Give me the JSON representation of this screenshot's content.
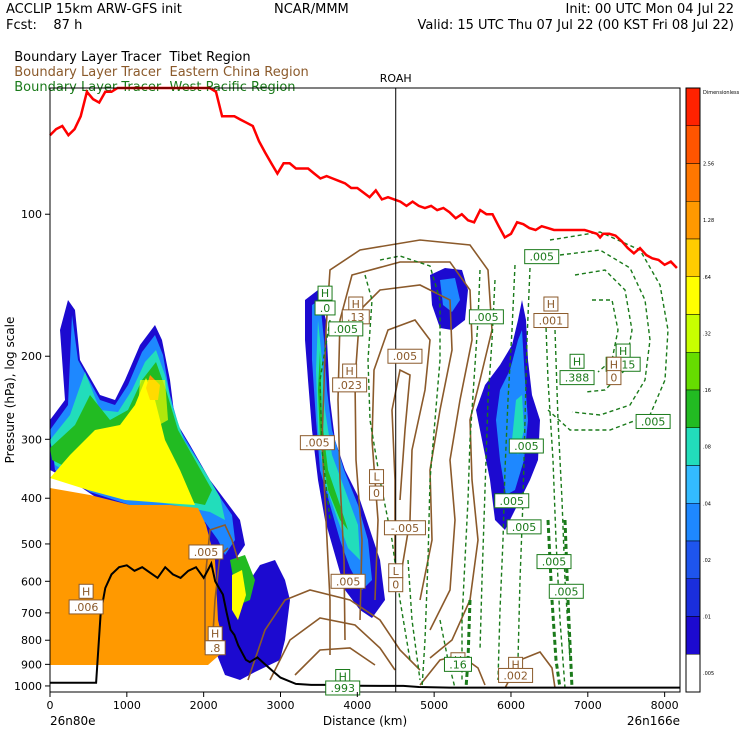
{
  "header": {
    "model": "ACCLIP 15km ARW-GFS init",
    "org": "NCAR/MMM",
    "init": "Init: 00 UTC Mon 04 Jul 22",
    "fcst": "Fcst:    87 h",
    "valid": "Valid: 15 UTC Thu 07 Jul 22 (00 KST Fri 08 Jul 22)"
  },
  "legend": [
    {
      "name": "Boundary Layer Tracer",
      "region": "Tibet Region",
      "color": "#000000"
    },
    {
      "name": "Boundary Layer Tracer",
      "region": "Eastern China Region",
      "color": "#8b5a2b"
    },
    {
      "name": "Boundary Layer Tracer",
      "region": "West Pacific Region",
      "color": "#1a7a1a"
    }
  ],
  "colors": {
    "tropopause": "#ff0000",
    "terrain": "#000000",
    "china": "#8b5a2b",
    "pacific": "#1a7a1a"
  },
  "chart_data": {
    "type": "cross-section",
    "marker_label": "ROAH",
    "marker_x": 4500,
    "xlabel": "Distance (km)",
    "ylabel": "Pressure (hPa), log scale",
    "x_range": [
      0,
      8200
    ],
    "y_range_hpa": [
      1030,
      54
    ],
    "y_scale": "log",
    "x_ticks": [
      "0",
      "1000",
      "2000",
      "3000",
      "4000",
      "5000",
      "6000",
      "7000",
      "8000"
    ],
    "x_tick_values": [
      0,
      1000,
      2000,
      3000,
      4000,
      5000,
      6000,
      7000,
      8000
    ],
    "y_ticks": [
      "1000",
      "900",
      "800",
      "700",
      "600",
      "500",
      "400",
      "300",
      "200",
      "100"
    ],
    "y_tick_values": [
      1000,
      900,
      800,
      700,
      600,
      500,
      400,
      300,
      200,
      100
    ],
    "endpoint_left": "26n80e",
    "endpoint_right": "26n166e",
    "colorbar_labels": [
      "Dimensionless",
      "2.56",
      "1.28",
      ".64",
      ".32",
      ".16",
      ".08",
      ".04",
      ".02",
      ".01",
      ".005"
    ],
    "colorbar_colors": [
      "#ff2200",
      "#ff5500",
      "#ff7700",
      "#ff9900",
      "#ffcc00",
      "#ffff00",
      "#c8ff00",
      "#66dd00",
      "#22bb22",
      "#22ddbb",
      "#33bbff",
      "#1e88ff",
      "#1e55ee",
      "#1a2edd",
      "#1c0ad0",
      "#ffffff"
    ],
    "tropopause": {
      "x": [
        0,
        80,
        160,
        240,
        320,
        400,
        480,
        560,
        640,
        720,
        800,
        880,
        960,
        1040,
        1120,
        1200,
        1280,
        1360,
        1440,
        1520,
        1600,
        1680,
        1760,
        1840,
        1920,
        2000,
        2080,
        2160,
        2240,
        2320,
        2400,
        2480,
        2560,
        2640,
        2720,
        2800,
        2880,
        2960,
        3040,
        3120,
        3200,
        3280,
        3360,
        3440,
        3520,
        3600,
        3680,
        3760,
        3840,
        3920,
        4000,
        4080,
        4160,
        4240,
        4320,
        4400,
        4480,
        4560,
        4640,
        4720,
        4800,
        4880,
        4960,
        5040,
        5120,
        5200,
        5280,
        5360,
        5440,
        5520,
        5600,
        5680,
        5760,
        5840,
        5920,
        6000,
        6080,
        6160,
        6240,
        6320,
        6400,
        6480,
        6560,
        6640,
        6720,
        6800,
        6880,
        6960,
        7040,
        7120,
        7160,
        7200,
        7280,
        7360,
        7440,
        7520,
        7600,
        7680,
        7760,
        7840,
        7920,
        8000,
        8080,
        8160
      ],
      "p": [
        68,
        66,
        65,
        68,
        66,
        62,
        55,
        57,
        58,
        55,
        55,
        54,
        54,
        54,
        54,
        54,
        54,
        54,
        54,
        54,
        54,
        54,
        54,
        54,
        54,
        54,
        54,
        55,
        62,
        62,
        62,
        63,
        64,
        65,
        70,
        74,
        78,
        82,
        78,
        78,
        80,
        80,
        80,
        82,
        84,
        83,
        84,
        85,
        86,
        88,
        88,
        90,
        92,
        89,
        93,
        92,
        93,
        94,
        96,
        94,
        96,
        97,
        96,
        98,
        97,
        99,
        102,
        100,
        103,
        104,
        98,
        100,
        100,
        106,
        112,
        110,
        104,
        105,
        107,
        108,
        106,
        107,
        108,
        108,
        108,
        108,
        108,
        108,
        109,
        110,
        112,
        110,
        110,
        111,
        114,
        118,
        121,
        118,
        122,
        124,
        125,
        128,
        126,
        130
      ]
    },
    "terrain": {
      "x": [
        0,
        300,
        600,
        660,
        720,
        800,
        900,
        1000,
        1100,
        1200,
        1300,
        1400,
        1500,
        1600,
        1700,
        1800,
        1900,
        2000,
        2050,
        2100,
        2150,
        2200,
        2250,
        2300,
        2350,
        2400,
        2450,
        2500,
        2550,
        2600,
        2700,
        2800,
        2900,
        3000,
        3200,
        3400,
        3600,
        3800,
        4000,
        4300,
        4600,
        4800,
        5200,
        5600,
        6000,
        6500,
        7000,
        7500,
        8000,
        8200
      ],
      "p": [
        985,
        985,
        985,
        700,
        620,
        580,
        560,
        555,
        570,
        560,
        575,
        590,
        560,
        580,
        590,
        570,
        560,
        590,
        570,
        550,
        600,
        620,
        640,
        700,
        760,
        780,
        820,
        850,
        880,
        890,
        870,
        900,
        930,
        960,
        990,
        995,
        995,
        998,
        999,
        1000,
        1000,
        1005,
        1008,
        1008,
        1008,
        1008,
        1008,
        1008,
        1008,
        1008
      ]
    },
    "labels": [
      {
        "text": ".005",
        "x": 2030,
        "p": 520,
        "color": "china"
      },
      {
        "text": "H",
        "x": 470,
        "p": 630,
        "color": "china"
      },
      {
        "text": ".006",
        "x": 470,
        "p": 680,
        "color": "china"
      },
      {
        "text": "H",
        "x": 2150,
        "p": 775,
        "color": "china"
      },
      {
        "text": ".8",
        "x": 2150,
        "p": 830,
        "color": "china"
      },
      {
        "text": "H",
        "x": 3580,
        "p": 147,
        "color": "pacific"
      },
      {
        "text": ".0",
        "x": 3580,
        "p": 158,
        "color": "pacific"
      },
      {
        "text": "H",
        "x": 3980,
        "p": 155,
        "color": "china"
      },
      {
        "text": ".13",
        "x": 3980,
        "p": 165,
        "color": "china"
      },
      {
        "text": ".005",
        "x": 3850,
        "p": 175,
        "color": "pacific"
      },
      {
        "text": ".005",
        "x": 4620,
        "p": 200,
        "color": "china"
      },
      {
        "text": "H",
        "x": 3900,
        "p": 215,
        "color": "china"
      },
      {
        "text": ".023",
        "x": 3900,
        "p": 230,
        "color": "china"
      },
      {
        "text": ".005",
        "x": 3480,
        "p": 305,
        "color": "china"
      },
      {
        "text": "L",
        "x": 4250,
        "p": 360,
        "color": "china"
      },
      {
        "text": "0",
        "x": 4250,
        "p": 390,
        "color": "china"
      },
      {
        "text": "-.005",
        "x": 4620,
        "p": 462,
        "color": "china"
      },
      {
        "text": "L",
        "x": 4500,
        "p": 570,
        "color": "china"
      },
      {
        "text": "0",
        "x": 4500,
        "p": 610,
        "color": "china"
      },
      {
        "text": ".005",
        "x": 3880,
        "p": 600,
        "color": "china"
      },
      {
        "text": ".005",
        "x": 5680,
        "p": 165,
        "color": "pacific"
      },
      {
        "text": ".005",
        "x": 6400,
        "p": 123,
        "color": "pacific"
      },
      {
        "text": "H",
        "x": 6520,
        "p": 155,
        "color": "china"
      },
      {
        "text": ".001",
        "x": 6520,
        "p": 168,
        "color": "china"
      },
      {
        "text": "H",
        "x": 6860,
        "p": 205,
        "color": "pacific"
      },
      {
        "text": ".388",
        "x": 6860,
        "p": 222,
        "color": "pacific"
      },
      {
        "text": "H",
        "x": 7460,
        "p": 195,
        "color": "pacific"
      },
      {
        "text": ".315",
        "x": 7460,
        "p": 208,
        "color": "pacific"
      },
      {
        "text": "H",
        "x": 7340,
        "p": 208,
        "color": "china"
      },
      {
        "text": "0",
        "x": 7340,
        "p": 222,
        "color": "china"
      },
      {
        "text": ".005",
        "x": 7850,
        "p": 275,
        "color": "pacific"
      },
      {
        "text": ".005",
        "x": 6200,
        "p": 310,
        "color": "pacific"
      },
      {
        "text": ".005",
        "x": 6010,
        "p": 405,
        "color": "pacific"
      },
      {
        "text": ".005",
        "x": 6170,
        "p": 460,
        "color": "pacific"
      },
      {
        "text": ".005",
        "x": 6560,
        "p": 545,
        "color": "pacific"
      },
      {
        "text": ".005",
        "x": 6720,
        "p": 630,
        "color": "pacific"
      },
      {
        "text": "H",
        "x": 5310,
        "p": 880,
        "color": "china"
      },
      {
        "text": ".16",
        "x": 5310,
        "p": 900,
        "color": "pacific"
      },
      {
        "text": "H",
        "x": 6060,
        "p": 900,
        "color": "china"
      },
      {
        "text": ".002",
        "x": 6060,
        "p": 950,
        "color": "china"
      },
      {
        "text": "H",
        "x": 3810,
        "p": 955,
        "color": "pacific"
      },
      {
        "text": ".993",
        "x": 3810,
        "p": 1010,
        "color": "pacific"
      }
    ]
  }
}
